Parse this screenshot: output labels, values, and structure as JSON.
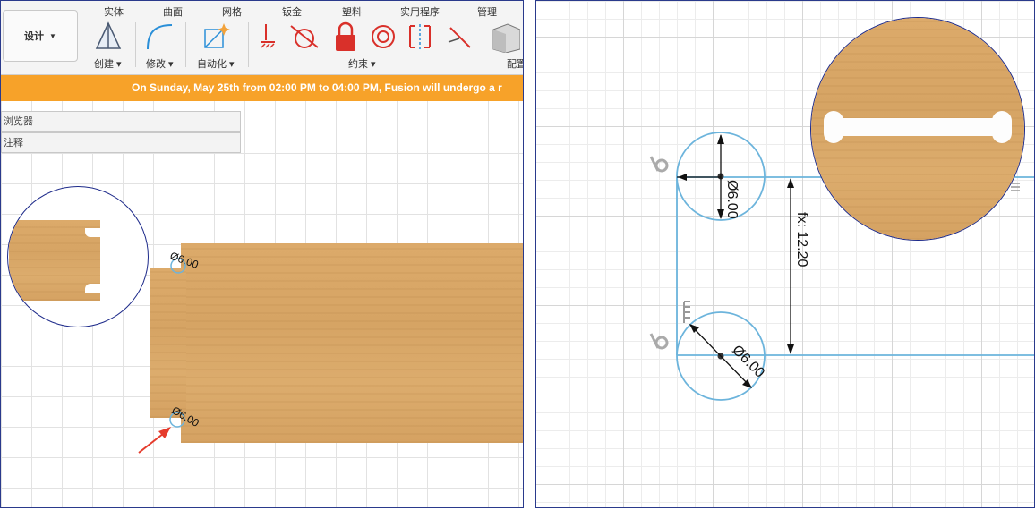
{
  "toolbar": {
    "workspace_label": "设计",
    "tabs": [
      "实体",
      "曲面",
      "网格",
      "钣金",
      "塑料",
      "实用程序",
      "管理"
    ],
    "groups": [
      "创建",
      "修改",
      "自动化",
      "约束",
      "配置"
    ],
    "icons": [
      "pyramid-icon",
      "fillet-curve-icon",
      "auto-constrain-icon",
      "fix-constraint-icon",
      "tangent-icon",
      "lock-icon",
      "concentric-icon",
      "midpoint-icon",
      "perpendicular-icon",
      "configure-box-icon"
    ]
  },
  "banner": {
    "text": "On Sunday, May 25th from 02:00 PM to 04:00 PM, Fusion will undergo a r",
    "color": "#f7a229"
  },
  "browser": {
    "items": [
      "浏览器",
      "注释"
    ]
  },
  "left_canvas": {
    "dim_top": "Ø6.00",
    "dim_bottom": "Ø6.00"
  },
  "right_canvas": {
    "dim_top": "Ø6.00",
    "dim_bottom": "Ø6.00",
    "dim_height": "fx: 12.20"
  },
  "colors": {
    "sketch_blue": "#6cb4dc",
    "arrow_red": "#e53b2c",
    "frame_navy": "#2a3a8c",
    "wood": "#d8a766"
  }
}
